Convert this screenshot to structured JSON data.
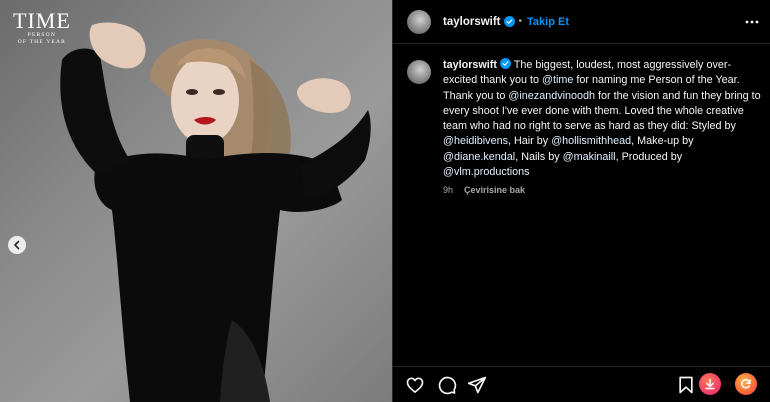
{
  "media": {
    "logo": {
      "word": "TIME",
      "line1": "PERSON",
      "line2": "OF THE YEAR"
    },
    "prev_icon": "chevron-left-icon"
  },
  "header": {
    "username": "taylorswift",
    "separator": "•",
    "follow_label": "Takip Et",
    "more_icon": "more-horizontal-icon"
  },
  "caption": {
    "username": "taylorswift",
    "parts": {
      "p1": " The biggest, loudest, most aggressively over-excited thank you to ",
      "m1": "@time",
      "p2": " for naming me Person of the Year. Thank you to ",
      "m2": "@inezandvinoodh",
      "p3": " for the vision and fun they bring to every shoot I've ever done with them. Loved the whole creative team who had no right to serve as hard as they did: Styled by ",
      "m3": "@heidibivens",
      "p4": ", Hair by ",
      "m4": "@hollismithhead",
      "p5": ", Make-up by ",
      "m5": "@diane.kendal",
      "p6": ", Nails by ",
      "m6": "@makinaill",
      "p7": ", Produced by ",
      "m7": "@vlm.productions"
    },
    "time_ago": "9h",
    "translate_label": "Çevirisine bak"
  },
  "actions": {
    "icons": [
      "heart-icon",
      "comment-icon",
      "share-icon",
      "bookmark-icon",
      "download-icon",
      "refresh-icon"
    ]
  },
  "colors": {
    "accent": "#0095f6",
    "verified": "#0095f6",
    "badge_pink": "#f0386b",
    "badge_orange": "#fd5b3a"
  }
}
